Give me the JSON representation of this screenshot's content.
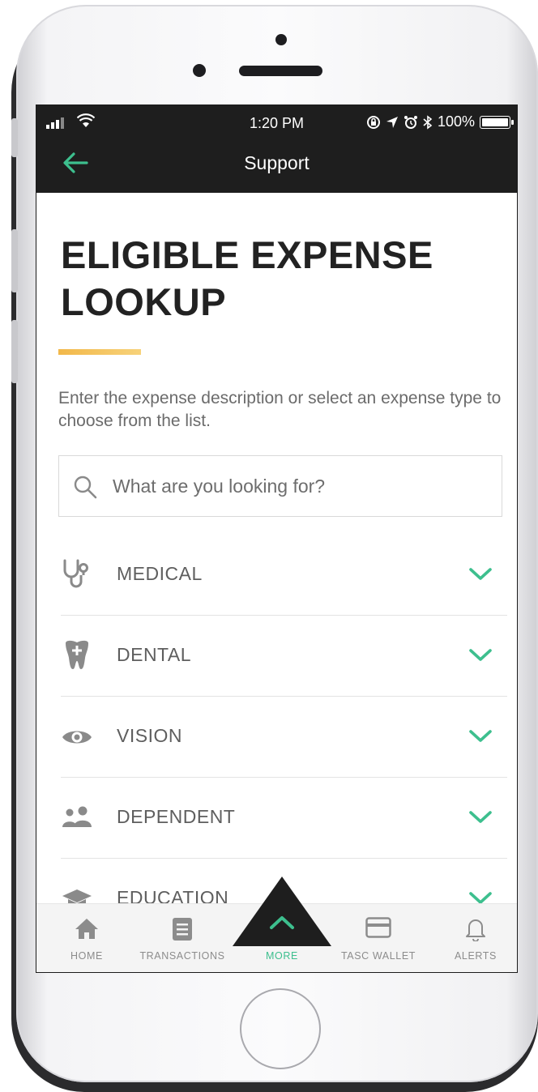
{
  "status_bar": {
    "time": "1:20 PM",
    "battery": "100%"
  },
  "nav": {
    "title": "Support"
  },
  "page": {
    "title": "ELIGIBLE EXPENSE LOOKUP",
    "intro": "Enter the expense description or select an expense type to choose from the list."
  },
  "search": {
    "placeholder": "What are you looking for?"
  },
  "categories": [
    {
      "label": "MEDICAL",
      "icon": "stethoscope-icon"
    },
    {
      "label": "DENTAL",
      "icon": "tooth-icon"
    },
    {
      "label": "VISION",
      "icon": "eye-icon"
    },
    {
      "label": "DEPENDENT",
      "icon": "people-icon"
    },
    {
      "label": "EDUCATION",
      "icon": "graduation-cap-icon"
    }
  ],
  "tabs": [
    {
      "label": "HOME",
      "icon": "home-icon"
    },
    {
      "label": "TRANSACTIONS",
      "icon": "transactions-icon"
    },
    {
      "label": "MORE",
      "icon": "chevron-up-icon",
      "active": true
    },
    {
      "label": "TASC WALLET",
      "icon": "card-icon"
    },
    {
      "label": "ALERTS",
      "icon": "bell-icon"
    }
  ],
  "colors": {
    "accent": "#3dbf8e",
    "header_bg": "#1e1e1e",
    "title_underline": "#f2b84a",
    "text_muted": "#6b6b6b"
  }
}
